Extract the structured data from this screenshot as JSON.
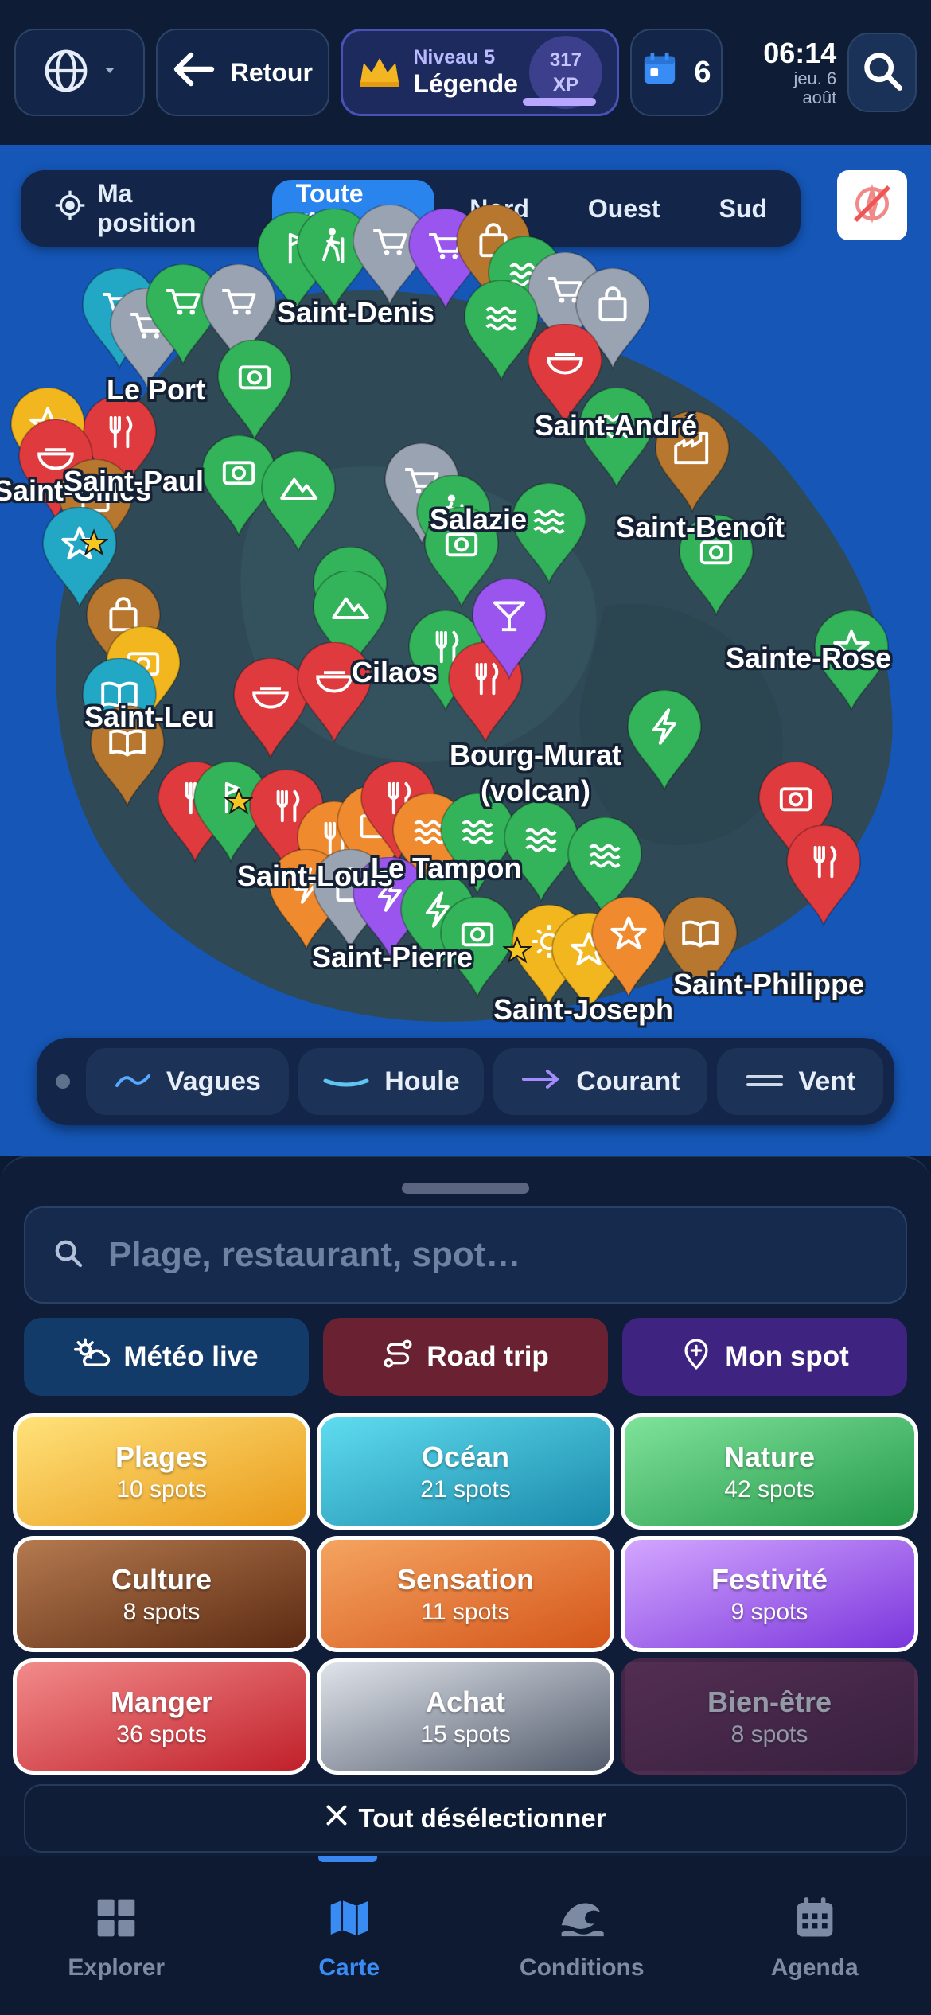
{
  "topbar": {
    "back_label": "Retour",
    "level_label": "Niveau 5",
    "level_title": "Légende",
    "xp_value": "317",
    "xp_unit": "XP",
    "xp_progress": 1.0,
    "calendar_count": "6",
    "time": "06:14",
    "date_line1": "jeu. 6",
    "date_line2": "août",
    "icons": [
      "globe-icon",
      "chevron-down-icon",
      "arrow-left-icon",
      "crown-icon",
      "calendar-icon",
      "search-icon"
    ]
  },
  "map": {
    "zone_chips": [
      {
        "label": "Ma position",
        "active": false
      },
      {
        "label": "Toute l'île",
        "active": true
      },
      {
        "label": "Nord",
        "active": false
      },
      {
        "label": "Ouest",
        "active": false
      },
      {
        "label": "Sud",
        "active": false
      }
    ],
    "cities": [
      "Saint-Denis",
      "Le Port",
      "Saint-André",
      "Saint-Gilles",
      "Saint-Paul",
      "Salazie",
      "Saint-Benoît",
      "Sainte-Rose",
      "Cilaos",
      "Saint-Leu",
      "Bourg-Murat (volcan)",
      "Saint-Louis",
      "Le Tampon",
      "Saint-Pierre",
      "Saint-Joseph",
      "Saint-Philippe"
    ],
    "layers": [
      {
        "label": "Vagues",
        "icon": "wave-icon",
        "color": "#58a8ff"
      },
      {
        "label": "Houle",
        "icon": "swell-icon",
        "color": "#5fc4f0"
      },
      {
        "label": "Courant",
        "icon": "arrow-right-icon",
        "color": "#a48cff"
      },
      {
        "label": "Vent",
        "icon": "wind-icon",
        "color": "#cfd8e6"
      }
    ]
  },
  "sheet": {
    "search_placeholder": "Plage, restaurant, spot…",
    "actions": [
      {
        "label": "Météo live",
        "icon": "weather-icon",
        "color": "#123b6a"
      },
      {
        "label": "Road trip",
        "icon": "route-icon",
        "color": "#6a2232"
      },
      {
        "label": "Mon spot",
        "icon": "pin-plus-icon",
        "color": "#3e2380"
      }
    ],
    "categories": [
      {
        "name": "Plages",
        "count": "10 spots",
        "selected": true,
        "color": "#f0b02a"
      },
      {
        "name": "Océan",
        "count": "21 spots",
        "selected": true,
        "color": "#22a7c4"
      },
      {
        "name": "Nature",
        "count": "42 spots",
        "selected": true,
        "color": "#34b15a"
      },
      {
        "name": "Culture",
        "count": "8 spots",
        "selected": true,
        "color": "#8a4c24"
      },
      {
        "name": "Sensation",
        "count": "11 spots",
        "selected": true,
        "color": "#ea7626"
      },
      {
        "name": "Festivité",
        "count": "9 spots",
        "selected": true,
        "color": "#9a55ee"
      },
      {
        "name": "Manger",
        "count": "36 spots",
        "selected": true,
        "color": "#d83a3e"
      },
      {
        "name": "Achat",
        "count": "15 spots",
        "selected": true,
        "color": "#8a94a6"
      },
      {
        "name": "Bien-être",
        "count": "8 spots",
        "selected": false,
        "color": "#7a3a66"
      }
    ],
    "deselect_label": "Tout désélectionner"
  },
  "nav": [
    {
      "label": "Explorer",
      "icon": "grid-icon",
      "active": false
    },
    {
      "label": "Carte",
      "icon": "map-icon",
      "active": true
    },
    {
      "label": "Conditions",
      "icon": "wave-icon",
      "active": false
    },
    {
      "label": "Agenda",
      "icon": "calendar-icon",
      "active": false
    }
  ]
}
